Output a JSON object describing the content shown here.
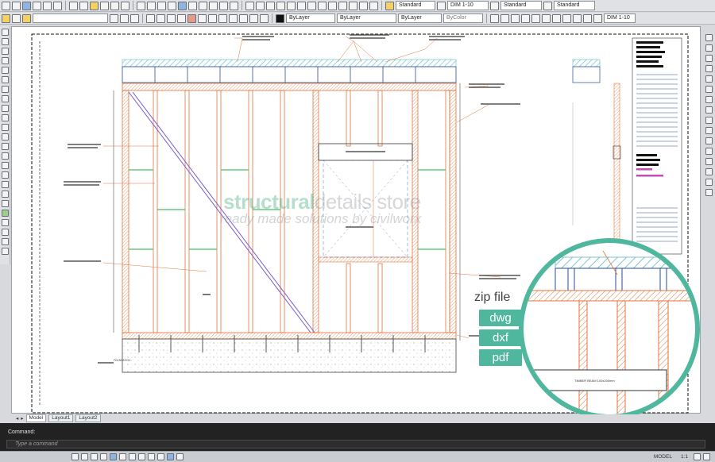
{
  "toolbar": {
    "text_style": "Standard",
    "dim_style": "DIM 1-10",
    "table_style": "Standard",
    "multileader_style": "Standard",
    "layer": "ByLayer",
    "linetype": "ByLayer",
    "lineweight": "ByLayer",
    "color": "ByColor",
    "dim_scale": "DIM 1-10"
  },
  "watermark": {
    "brand_green": "structural",
    "brand_grey": "details store",
    "tagline": "ready made solutions by civilworx"
  },
  "downloads": {
    "heading": "zip file",
    "formats": [
      "dwg",
      "dxf",
      "pdf"
    ]
  },
  "layout_tabs": [
    "Model",
    "Layout1",
    "Layout2"
  ],
  "command": {
    "history": "Command:",
    "placeholder": "Type a command"
  },
  "status_bar": {
    "mode": "MODEL",
    "scale": "1:1"
  },
  "drawing_labels": {
    "beam_zoom": "TIMBER BEAM 100x200mm",
    "beam_main": "TIMBER BEAM 100x200mm",
    "foundation": "FOUNDATION"
  },
  "colors": {
    "accent": "#4fb79d",
    "stud": "#e0763f",
    "bracing": "#7b5cc9",
    "nogging": "#4bbf63",
    "hatch": "#5fb8c4"
  }
}
